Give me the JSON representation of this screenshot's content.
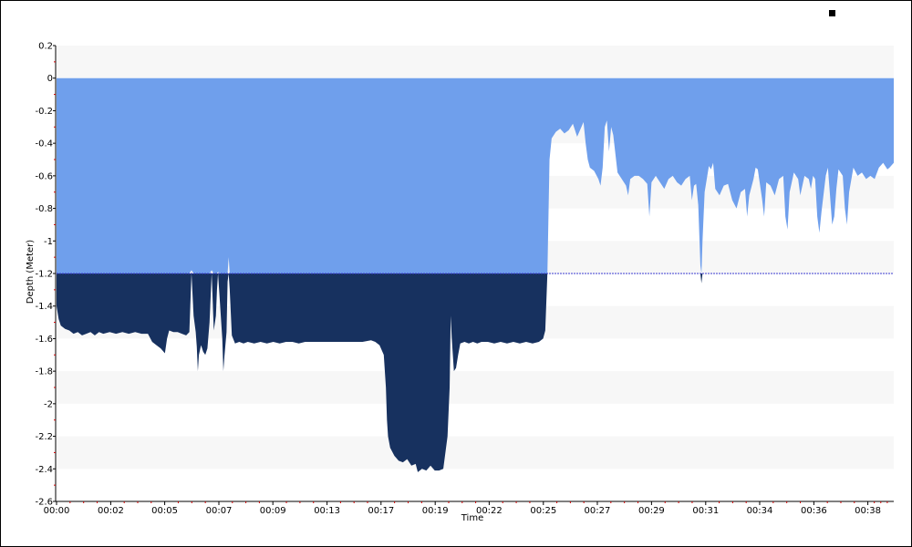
{
  "chart_data": {
    "type": "area",
    "xlabel": "Time",
    "ylabel": "Depth (Meter)",
    "ylim": [
      -2.6,
      0.2
    ],
    "xlim_minutes": [
      0,
      39.4
    ],
    "y_ticks": [
      "0.2",
      "0",
      "-0.2",
      "-0.4",
      "-0.6",
      "-0.8",
      "-1",
      "-1.2",
      "-1.4",
      "-1.6",
      "-1.8",
      "-2",
      "-2.2",
      "-2.4",
      "-2.6"
    ],
    "x_ticks": [
      {
        "label": "00:00",
        "minutes": 0
      },
      {
        "label": "00:02",
        "minutes": 2.55
      },
      {
        "label": "00:05",
        "minutes": 5.09
      },
      {
        "label": "00:07",
        "minutes": 7.64
      },
      {
        "label": "00:09",
        "minutes": 10.18
      },
      {
        "label": "00:13",
        "minutes": 12.73
      },
      {
        "label": "00:17",
        "minutes": 15.27
      },
      {
        "label": "00:19",
        "minutes": 17.82
      },
      {
        "label": "00:22",
        "minutes": 20.36
      },
      {
        "label": "00:25",
        "minutes": 22.91
      },
      {
        "label": "00:27",
        "minutes": 25.45
      },
      {
        "label": "00:29",
        "minutes": 28.0
      },
      {
        "label": "00:31",
        "minutes": 30.55
      },
      {
        "label": "00:34",
        "minutes": 33.09
      },
      {
        "label": "00:36",
        "minutes": 35.64
      },
      {
        "label": "00:38",
        "minutes": 38.18
      }
    ],
    "threshold_depth": -1.2,
    "grid": "alternating horizontal bands",
    "colors": {
      "above_threshold": "#6f9fec",
      "below_threshold": "#17315f",
      "threshold_line": "#3b3bd1",
      "band": "#f7f7f7",
      "tick_mark": "#cc0000"
    },
    "series": [
      {
        "points": [
          [
            0.0,
            -1.4
          ],
          [
            0.1,
            -1.48
          ],
          [
            0.2,
            -1.52
          ],
          [
            0.4,
            -1.54
          ],
          [
            0.6,
            -1.55
          ],
          [
            0.8,
            -1.57
          ],
          [
            1.0,
            -1.56
          ],
          [
            1.2,
            -1.58
          ],
          [
            1.4,
            -1.57
          ],
          [
            1.6,
            -1.56
          ],
          [
            1.8,
            -1.58
          ],
          [
            2.0,
            -1.56
          ],
          [
            2.2,
            -1.57
          ],
          [
            2.5,
            -1.56
          ],
          [
            2.8,
            -1.57
          ],
          [
            3.1,
            -1.56
          ],
          [
            3.4,
            -1.57
          ],
          [
            3.7,
            -1.56
          ],
          [
            4.0,
            -1.57
          ],
          [
            4.3,
            -1.57
          ],
          [
            4.5,
            -1.62
          ],
          [
            4.7,
            -1.64
          ],
          [
            4.9,
            -1.66
          ],
          [
            5.1,
            -1.69
          ],
          [
            5.2,
            -1.6
          ],
          [
            5.3,
            -1.55
          ],
          [
            5.5,
            -1.56
          ],
          [
            5.7,
            -1.56
          ],
          [
            5.9,
            -1.57
          ],
          [
            6.1,
            -1.58
          ],
          [
            6.25,
            -1.56
          ],
          [
            6.35,
            -1.18
          ],
          [
            6.45,
            -1.46
          ],
          [
            6.55,
            -1.56
          ],
          [
            6.6,
            -1.65
          ],
          [
            6.65,
            -1.8
          ],
          [
            6.7,
            -1.7
          ],
          [
            6.8,
            -1.64
          ],
          [
            6.9,
            -1.68
          ],
          [
            7.0,
            -1.7
          ],
          [
            7.1,
            -1.66
          ],
          [
            7.2,
            -1.5
          ],
          [
            7.3,
            -1.18
          ],
          [
            7.4,
            -1.55
          ],
          [
            7.5,
            -1.46
          ],
          [
            7.55,
            -1.3
          ],
          [
            7.6,
            -1.19
          ],
          [
            7.7,
            -1.4
          ],
          [
            7.8,
            -1.6
          ],
          [
            7.85,
            -1.8
          ],
          [
            7.9,
            -1.71
          ],
          [
            8.0,
            -1.56
          ],
          [
            8.05,
            -1.25
          ],
          [
            8.1,
            -1.1
          ],
          [
            8.15,
            -1.3
          ],
          [
            8.25,
            -1.58
          ],
          [
            8.4,
            -1.63
          ],
          [
            8.6,
            -1.62
          ],
          [
            8.8,
            -1.63
          ],
          [
            9.0,
            -1.62
          ],
          [
            9.3,
            -1.63
          ],
          [
            9.6,
            -1.62
          ],
          [
            9.9,
            -1.63
          ],
          [
            10.2,
            -1.62
          ],
          [
            10.5,
            -1.63
          ],
          [
            10.8,
            -1.62
          ],
          [
            11.1,
            -1.62
          ],
          [
            11.4,
            -1.63
          ],
          [
            11.7,
            -1.62
          ],
          [
            12.0,
            -1.62
          ],
          [
            12.4,
            -1.62
          ],
          [
            12.8,
            -1.62
          ],
          [
            13.2,
            -1.62
          ],
          [
            13.6,
            -1.62
          ],
          [
            14.0,
            -1.62
          ],
          [
            14.4,
            -1.62
          ],
          [
            14.8,
            -1.61
          ],
          [
            15.0,
            -1.62
          ],
          [
            15.2,
            -1.64
          ],
          [
            15.4,
            -1.7
          ],
          [
            15.5,
            -1.9
          ],
          [
            15.55,
            -2.1
          ],
          [
            15.6,
            -2.2
          ],
          [
            15.7,
            -2.27
          ],
          [
            15.9,
            -2.32
          ],
          [
            16.1,
            -2.35
          ],
          [
            16.3,
            -2.36
          ],
          [
            16.5,
            -2.34
          ],
          [
            16.7,
            -2.38
          ],
          [
            16.9,
            -2.37
          ],
          [
            17.0,
            -2.42
          ],
          [
            17.2,
            -2.4
          ],
          [
            17.4,
            -2.41
          ],
          [
            17.6,
            -2.38
          ],
          [
            17.8,
            -2.41
          ],
          [
            18.0,
            -2.41
          ],
          [
            18.2,
            -2.4
          ],
          [
            18.4,
            -2.2
          ],
          [
            18.5,
            -1.9
          ],
          [
            18.55,
            -1.46
          ],
          [
            18.6,
            -1.6
          ],
          [
            18.7,
            -1.8
          ],
          [
            18.8,
            -1.78
          ],
          [
            18.9,
            -1.7
          ],
          [
            19.0,
            -1.63
          ],
          [
            19.2,
            -1.62
          ],
          [
            19.4,
            -1.63
          ],
          [
            19.6,
            -1.62
          ],
          [
            19.8,
            -1.63
          ],
          [
            20.0,
            -1.62
          ],
          [
            20.3,
            -1.62
          ],
          [
            20.6,
            -1.63
          ],
          [
            20.9,
            -1.62
          ],
          [
            21.2,
            -1.63
          ],
          [
            21.5,
            -1.62
          ],
          [
            21.8,
            -1.63
          ],
          [
            22.1,
            -1.62
          ],
          [
            22.4,
            -1.63
          ],
          [
            22.7,
            -1.62
          ],
          [
            22.9,
            -1.6
          ],
          [
            23.0,
            -1.55
          ],
          [
            23.1,
            -1.2
          ],
          [
            23.2,
            -0.5
          ],
          [
            23.3,
            -0.37
          ],
          [
            23.5,
            -0.33
          ],
          [
            23.7,
            -0.31
          ],
          [
            23.9,
            -0.34
          ],
          [
            24.1,
            -0.32
          ],
          [
            24.3,
            -0.28
          ],
          [
            24.5,
            -0.36
          ],
          [
            24.7,
            -0.3
          ],
          [
            24.8,
            -0.27
          ],
          [
            24.9,
            -0.4
          ],
          [
            25.0,
            -0.5
          ],
          [
            25.1,
            -0.55
          ],
          [
            25.3,
            -0.57
          ],
          [
            25.5,
            -0.62
          ],
          [
            25.6,
            -0.66
          ],
          [
            25.7,
            -0.55
          ],
          [
            25.8,
            -0.3
          ],
          [
            25.9,
            -0.26
          ],
          [
            26.0,
            -0.45
          ],
          [
            26.1,
            -0.3
          ],
          [
            26.2,
            -0.35
          ],
          [
            26.4,
            -0.58
          ],
          [
            26.6,
            -0.62
          ],
          [
            26.8,
            -0.66
          ],
          [
            26.9,
            -0.72
          ],
          [
            27.0,
            -0.62
          ],
          [
            27.2,
            -0.6
          ],
          [
            27.4,
            -0.6
          ],
          [
            27.6,
            -0.62
          ],
          [
            27.8,
            -0.65
          ],
          [
            27.9,
            -0.85
          ],
          [
            28.0,
            -0.64
          ],
          [
            28.2,
            -0.6
          ],
          [
            28.4,
            -0.64
          ],
          [
            28.6,
            -0.68
          ],
          [
            28.8,
            -0.62
          ],
          [
            29.0,
            -0.6
          ],
          [
            29.2,
            -0.64
          ],
          [
            29.4,
            -0.66
          ],
          [
            29.6,
            -0.62
          ],
          [
            29.8,
            -0.6
          ],
          [
            29.9,
            -0.75
          ],
          [
            30.0,
            -0.66
          ],
          [
            30.1,
            -0.65
          ],
          [
            30.2,
            -0.78
          ],
          [
            30.3,
            -1.15
          ],
          [
            30.35,
            -1.26
          ],
          [
            30.4,
            -1.0
          ],
          [
            30.5,
            -0.7
          ],
          [
            30.6,
            -0.62
          ],
          [
            30.7,
            -0.54
          ],
          [
            30.8,
            -0.56
          ],
          [
            30.9,
            -0.52
          ],
          [
            31.0,
            -0.68
          ],
          [
            31.2,
            -0.72
          ],
          [
            31.4,
            -0.66
          ],
          [
            31.6,
            -0.65
          ],
          [
            31.8,
            -0.75
          ],
          [
            32.0,
            -0.8
          ],
          [
            32.2,
            -0.7
          ],
          [
            32.4,
            -0.68
          ],
          [
            32.5,
            -0.85
          ],
          [
            32.6,
            -0.72
          ],
          [
            32.8,
            -0.62
          ],
          [
            32.9,
            -0.55
          ],
          [
            33.0,
            -0.56
          ],
          [
            33.2,
            -0.74
          ],
          [
            33.3,
            -0.85
          ],
          [
            33.4,
            -0.64
          ],
          [
            33.6,
            -0.66
          ],
          [
            33.8,
            -0.72
          ],
          [
            34.0,
            -0.62
          ],
          [
            34.2,
            -0.6
          ],
          [
            34.3,
            -0.85
          ],
          [
            34.4,
            -0.93
          ],
          [
            34.5,
            -0.7
          ],
          [
            34.7,
            -0.58
          ],
          [
            34.9,
            -0.62
          ],
          [
            35.0,
            -0.72
          ],
          [
            35.2,
            -0.6
          ],
          [
            35.4,
            -0.62
          ],
          [
            35.5,
            -0.68
          ],
          [
            35.6,
            -0.6
          ],
          [
            35.7,
            -0.62
          ],
          [
            35.8,
            -0.85
          ],
          [
            35.9,
            -0.95
          ],
          [
            36.0,
            -0.82
          ],
          [
            36.2,
            -0.6
          ],
          [
            36.3,
            -0.55
          ],
          [
            36.4,
            -0.72
          ],
          [
            36.5,
            -0.9
          ],
          [
            36.6,
            -0.85
          ],
          [
            36.7,
            -0.68
          ],
          [
            36.8,
            -0.56
          ],
          [
            37.0,
            -0.6
          ],
          [
            37.1,
            -0.8
          ],
          [
            37.2,
            -0.9
          ],
          [
            37.3,
            -0.7
          ],
          [
            37.5,
            -0.55
          ],
          [
            37.7,
            -0.6
          ],
          [
            37.9,
            -0.58
          ],
          [
            38.1,
            -0.62
          ],
          [
            38.3,
            -0.6
          ],
          [
            38.5,
            -0.62
          ],
          [
            38.7,
            -0.55
          ],
          [
            38.9,
            -0.52
          ],
          [
            39.1,
            -0.56
          ],
          [
            39.2,
            -0.55
          ],
          [
            39.4,
            -0.52
          ]
        ]
      }
    ]
  }
}
